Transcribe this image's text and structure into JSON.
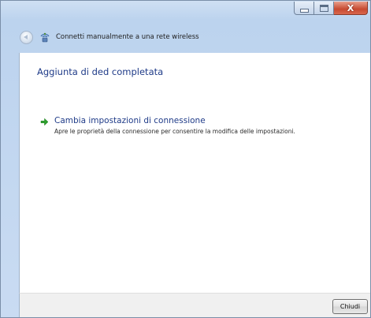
{
  "window": {
    "nav_title": "Connetti manualmente a una rete wireless"
  },
  "content": {
    "heading": "Aggiunta di ded completata",
    "task": {
      "title": "Cambia impostazioni di connessione",
      "description": "Apre le proprietà della connessione per consentire la modifica delle impostazioni."
    }
  },
  "footer": {
    "close_label": "Chiudi"
  },
  "icons": {
    "back": "back-arrow-icon",
    "network": "wireless-network-icon",
    "task": "green-arrow-icon",
    "minimize": "minimize-icon",
    "maximize": "maximize-icon",
    "close": "close-icon"
  },
  "colors": {
    "link": "#1f3b88",
    "arrow": "#2ea12e",
    "close_button": "#c74a31"
  }
}
